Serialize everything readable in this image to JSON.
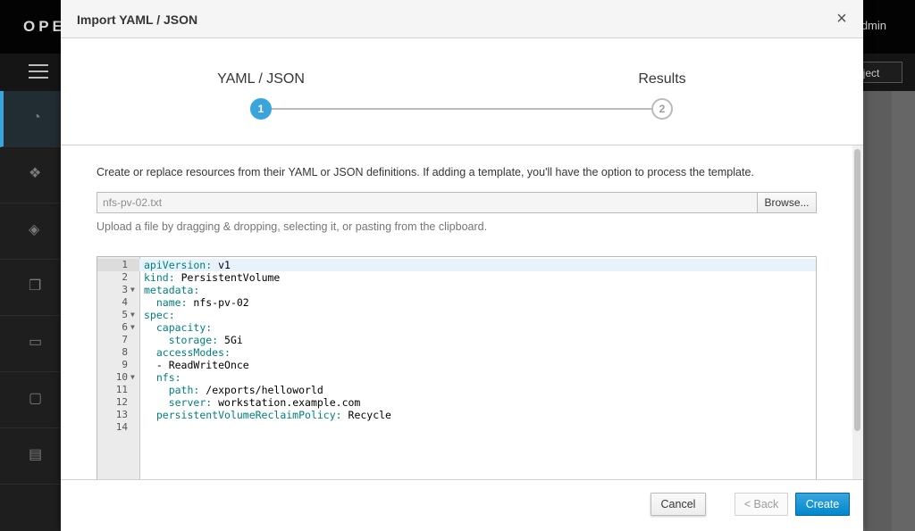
{
  "background": {
    "brand": "OPE",
    "user": "dmin",
    "project_selector": "oject"
  },
  "modal": {
    "title": "Import YAML / JSON",
    "close_icon": "×",
    "wizard": {
      "steps": [
        {
          "label": "YAML / JSON",
          "number": "1",
          "state": "active"
        },
        {
          "label": "Results",
          "number": "2",
          "state": "inactive"
        }
      ]
    },
    "description": "Create or replace resources from their YAML or JSON definitions. If adding a template, you'll have the option to process the template.",
    "file_input": {
      "value": "nfs-pv-02.txt"
    },
    "browse_label": "Browse...",
    "help_text": "Upload a file by dragging & dropping, selecting it, or pasting from the clipboard.",
    "editor": {
      "lines": [
        {
          "n": "1",
          "key": "apiVersion",
          "value": " v1",
          "indent": "",
          "fold": false
        },
        {
          "n": "2",
          "key": "kind",
          "value": " PersistentVolume",
          "indent": "",
          "fold": false
        },
        {
          "n": "3",
          "key": "metadata",
          "value": "",
          "indent": "",
          "fold": true
        },
        {
          "n": "4",
          "key": "name",
          "value": " nfs-pv-02",
          "indent": "  ",
          "fold": false
        },
        {
          "n": "5",
          "key": "spec",
          "value": "",
          "indent": "",
          "fold": true
        },
        {
          "n": "6",
          "key": "capacity",
          "value": "",
          "indent": "  ",
          "fold": true
        },
        {
          "n": "7",
          "key": "storage",
          "value": " 5Gi",
          "indent": "    ",
          "fold": false
        },
        {
          "n": "8",
          "key": "accessModes",
          "value": "",
          "indent": "  ",
          "fold": false
        },
        {
          "n": "9",
          "key": "",
          "value": "- ReadWriteOnce",
          "indent": "  ",
          "fold": false
        },
        {
          "n": "10",
          "key": "nfs",
          "value": "",
          "indent": "  ",
          "fold": true
        },
        {
          "n": "11",
          "key": "path",
          "value": " /exports/helloworld",
          "indent": "    ",
          "fold": false
        },
        {
          "n": "12",
          "key": "server",
          "value": " workstation.example.com",
          "indent": "    ",
          "fold": false
        },
        {
          "n": "13",
          "key": "persistentVolumeReclaimPolicy",
          "value": " Recycle",
          "indent": "  ",
          "fold": false
        },
        {
          "n": "14",
          "key": "",
          "value": "",
          "indent": "",
          "fold": false
        }
      ]
    },
    "footer": {
      "cancel_label": "Cancel",
      "back_label": "< Back",
      "create_label": "Create"
    }
  },
  "colors": {
    "accent": "#39a5dc",
    "primary_button": "#0088ce"
  }
}
